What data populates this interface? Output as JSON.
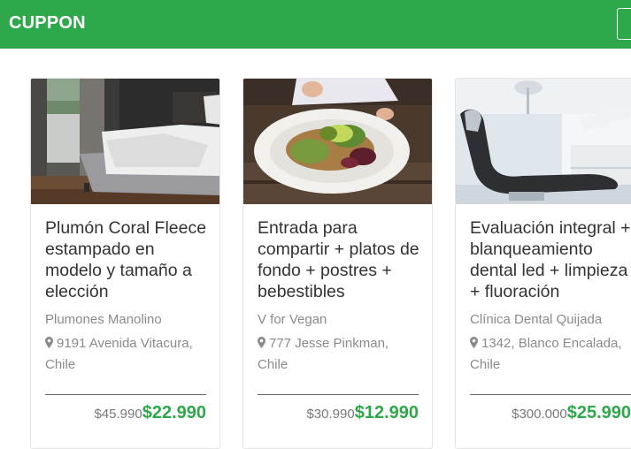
{
  "header": {
    "brand": "CUPPON"
  },
  "colors": {
    "accent": "#2ea84a",
    "text": "#333333",
    "muted": "#8a8a8a"
  },
  "cards": [
    {
      "title": "Plumón Coral Fleece estampado en modelo y tamaño a elección",
      "merchant": "Plumones Manolino",
      "address": "9191 Avenida Vitacura, Chile",
      "old_price": "$45.990",
      "new_price": "$22.990",
      "image": "bedroom-photo"
    },
    {
      "title": "Entrada para compartir + platos de fondo + postres + bebestibles",
      "merchant": "V for Vegan",
      "address": "777 Jesse Pinkman, Chile",
      "old_price": "$30.990",
      "new_price": "$12.990",
      "image": "salad-bowl-photo"
    },
    {
      "title": "Evaluación integral + blanqueamiento dental led + limpieza + fluoración",
      "merchant": "Clínica Dental Quijada",
      "address": "1342, Blanco Encalada, Chile",
      "old_price": "$300.000",
      "new_price": "$25.990",
      "image": "dental-chair-photo"
    }
  ]
}
